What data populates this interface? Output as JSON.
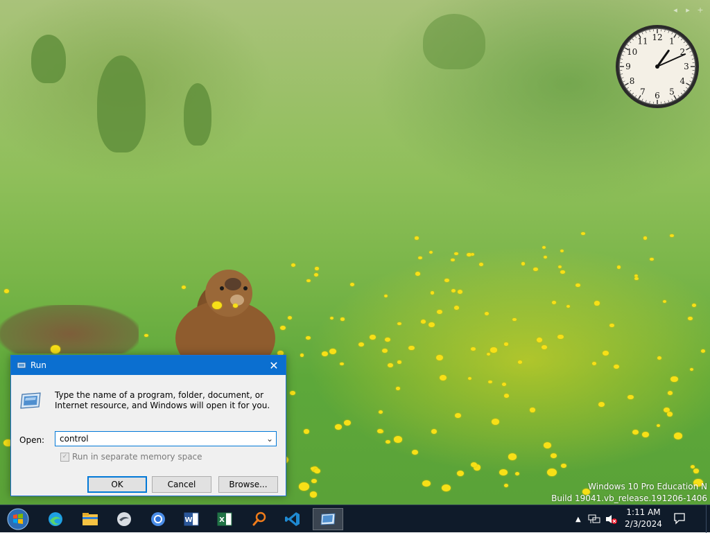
{
  "dialog": {
    "title": "Run",
    "description": "Type the name of a program, folder, document, or Internet resource, and Windows will open it for you.",
    "open_label": "Open:",
    "open_value": "control",
    "checkbox_label": "Run in separate memory space",
    "ok_label": "OK",
    "cancel_label": "Cancel",
    "browse_label": "Browse..."
  },
  "watermark": {
    "line1": "Windows 10 Pro Education N",
    "line2": "Build 19041.vb_release.191206-1406"
  },
  "tray": {
    "time": "1:11 AM",
    "date": "2/3/2024"
  },
  "clock": {
    "hour": 1,
    "minute": 11
  },
  "colors": {
    "titlebar": "#0b6fd0",
    "taskbar": "#0f1b2a",
    "accent": "#0078d7"
  },
  "taskbar_icons": [
    "start-orb-icon",
    "edge-icon",
    "file-explorer-icon",
    "app-icon",
    "chrome-icon",
    "word-icon",
    "excel-icon",
    "search-icon",
    "vscode-icon",
    "run-icon"
  ]
}
